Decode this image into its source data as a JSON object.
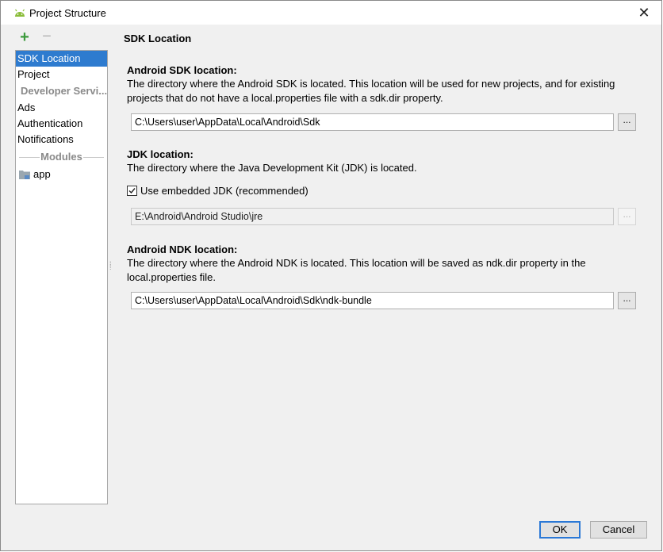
{
  "window": {
    "title": "Project Structure",
    "close_glyph": "✕"
  },
  "toolbar": {
    "add_glyph": "+",
    "remove_glyph": "−"
  },
  "sidebar": {
    "items": [
      {
        "label": "SDK Location",
        "selected": true
      },
      {
        "label": "Project",
        "selected": false
      }
    ],
    "group_developer": "Developer Servi...",
    "developer_items": [
      "Ads",
      "Authentication",
      "Notifications"
    ],
    "group_modules": "Modules",
    "modules": [
      "app"
    ]
  },
  "content": {
    "page_title": "SDK Location",
    "android_sdk": {
      "title": "Android SDK location:",
      "desc_line1": "The directory where the Android SDK is located. This location will be used for new projects, and for existing",
      "desc_line2": "projects that do not have a local.properties file with a sdk.dir property.",
      "path": "C:\\Users\\user\\AppData\\Local\\Android\\Sdk",
      "browse": "..."
    },
    "jdk": {
      "title": "JDK location:",
      "desc": "The directory where the Java Development Kit (JDK) is located.",
      "embedded_label": "Use embedded JDK (recommended)",
      "embedded_checked": true,
      "path": "E:\\Android\\Android Studio\\jre",
      "browse": "..."
    },
    "android_ndk": {
      "title": "Android NDK location:",
      "desc_line1": "The directory where the Android NDK is located. This location will be saved as ndk.dir property in the",
      "desc_line2": "local.properties file.",
      "path": "C:\\Users\\user\\AppData\\Local\\Android\\Sdk\\ndk-bundle",
      "browse": "..."
    }
  },
  "buttons": {
    "ok": "OK",
    "cancel": "Cancel"
  },
  "colors": {
    "selection": "#2e7bcf",
    "add_icon": "#3c9a3c",
    "ok_border": "#2a78d6"
  }
}
